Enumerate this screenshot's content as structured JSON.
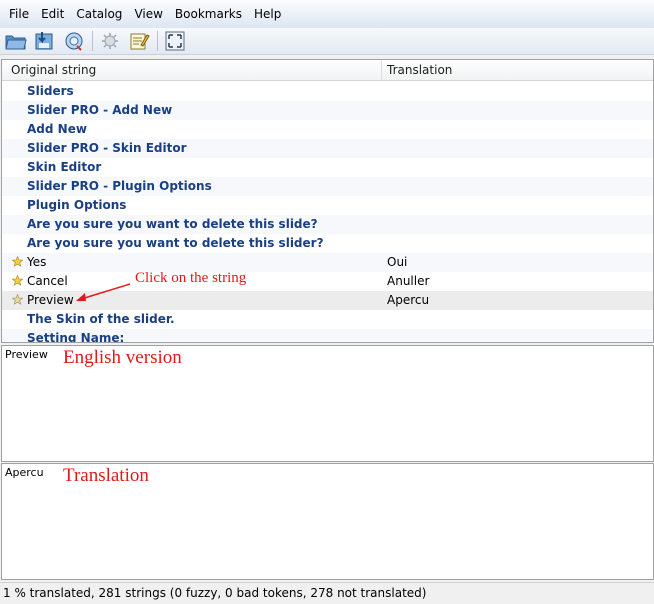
{
  "menu": [
    "File",
    "Edit",
    "Catalog",
    "View",
    "Bookmarks",
    "Help"
  ],
  "toolbar": {
    "buttons": [
      "open-icon",
      "save-icon",
      "update-icon",
      "validate-icon",
      "comment-icon",
      "fullscreen-icon"
    ]
  },
  "list": {
    "columns": {
      "original": "Original string",
      "translation": "Translation"
    },
    "rows": [
      {
        "src": "Sliders",
        "tr": ""
      },
      {
        "src": "Slider PRO - Add New",
        "tr": ""
      },
      {
        "src": "Add New",
        "tr": ""
      },
      {
        "src": "Slider PRO - Skin Editor",
        "tr": ""
      },
      {
        "src": "Skin Editor",
        "tr": ""
      },
      {
        "src": "Slider PRO - Plugin Options",
        "tr": ""
      },
      {
        "src": "Plugin Options",
        "tr": ""
      },
      {
        "src": "Are you sure you want to delete this slide?",
        "tr": ""
      },
      {
        "src": "Are you sure you want to delete this slider?",
        "tr": ""
      },
      {
        "src": "Yes",
        "tr": "Oui"
      },
      {
        "src": "Cancel",
        "tr": "Anuller"
      },
      {
        "src": "Preview",
        "tr": "Apercu"
      },
      {
        "src": "The Skin of the slider.",
        "tr": ""
      },
      {
        "src": "Setting Name:",
        "tr": ""
      }
    ]
  },
  "annotations": {
    "click": "Click on the string",
    "english": "English version",
    "translation": "Translation"
  },
  "source_pane": {
    "text": "Preview"
  },
  "translation_pane": {
    "text": "Apercu"
  },
  "status": "1 % translated, 281 strings (0 fuzzy, 0 bad tokens, 278 not translated)",
  "colors": {
    "untranslated": "#1a3f82",
    "annotation": "#e01a1a",
    "selected_row": "#ececec"
  }
}
